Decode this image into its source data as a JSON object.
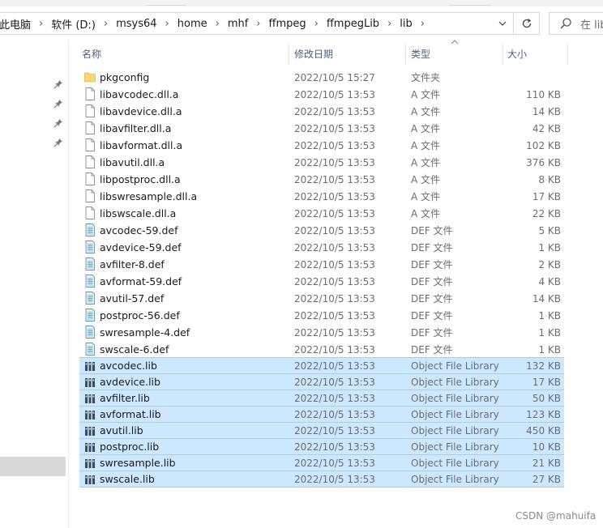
{
  "address_bar": {
    "crumbs": [
      "此电脑",
      "软件 (D:)",
      "msys64",
      "home",
      "mhf",
      "ffmpeg",
      "ffmpegLib",
      "lib"
    ],
    "separator": "›"
  },
  "search": {
    "placeholder": "在 lib"
  },
  "columns": {
    "name": "名称",
    "date": "修改日期",
    "type": "类型",
    "size": "大小"
  },
  "sort": {
    "column": "type",
    "direction": "ascending"
  },
  "colors": {
    "selection_bg": "#cce8ff",
    "selection_border": "#99d1ff",
    "folder": "#f8d775",
    "header_text": "#4d6082"
  },
  "files": [
    {
      "name": "pkgconfig",
      "date": "2022/10/5 15:27",
      "type": "文件夹",
      "size": "",
      "icon": "folder-icon",
      "selected": false
    },
    {
      "name": "libavcodec.dll.a",
      "date": "2022/10/5 13:53",
      "type": "A 文件",
      "size": "110 KB",
      "icon": "file-icon",
      "selected": false
    },
    {
      "name": "libavdevice.dll.a",
      "date": "2022/10/5 13:53",
      "type": "A 文件",
      "size": "14 KB",
      "icon": "file-icon",
      "selected": false
    },
    {
      "name": "libavfilter.dll.a",
      "date": "2022/10/5 13:53",
      "type": "A 文件",
      "size": "42 KB",
      "icon": "file-icon",
      "selected": false
    },
    {
      "name": "libavformat.dll.a",
      "date": "2022/10/5 13:53",
      "type": "A 文件",
      "size": "102 KB",
      "icon": "file-icon",
      "selected": false
    },
    {
      "name": "libavutil.dll.a",
      "date": "2022/10/5 13:53",
      "type": "A 文件",
      "size": "376 KB",
      "icon": "file-icon",
      "selected": false
    },
    {
      "name": "libpostproc.dll.a",
      "date": "2022/10/5 13:53",
      "type": "A 文件",
      "size": "8 KB",
      "icon": "file-icon",
      "selected": false
    },
    {
      "name": "libswresample.dll.a",
      "date": "2022/10/5 13:53",
      "type": "A 文件",
      "size": "17 KB",
      "icon": "file-icon",
      "selected": false
    },
    {
      "name": "libswscale.dll.a",
      "date": "2022/10/5 13:53",
      "type": "A 文件",
      "size": "22 KB",
      "icon": "file-icon",
      "selected": false
    },
    {
      "name": "avcodec-59.def",
      "date": "2022/10/5 13:53",
      "type": "DEF 文件",
      "size": "5 KB",
      "icon": "def-file-icon",
      "selected": false
    },
    {
      "name": "avdevice-59.def",
      "date": "2022/10/5 13:53",
      "type": "DEF 文件",
      "size": "1 KB",
      "icon": "def-file-icon",
      "selected": false
    },
    {
      "name": "avfilter-8.def",
      "date": "2022/10/5 13:53",
      "type": "DEF 文件",
      "size": "2 KB",
      "icon": "def-file-icon",
      "selected": false
    },
    {
      "name": "avformat-59.def",
      "date": "2022/10/5 13:53",
      "type": "DEF 文件",
      "size": "4 KB",
      "icon": "def-file-icon",
      "selected": false
    },
    {
      "name": "avutil-57.def",
      "date": "2022/10/5 13:53",
      "type": "DEF 文件",
      "size": "14 KB",
      "icon": "def-file-icon",
      "selected": false
    },
    {
      "name": "postproc-56.def",
      "date": "2022/10/5 13:53",
      "type": "DEF 文件",
      "size": "1 KB",
      "icon": "def-file-icon",
      "selected": false
    },
    {
      "name": "swresample-4.def",
      "date": "2022/10/5 13:53",
      "type": "DEF 文件",
      "size": "1 KB",
      "icon": "def-file-icon",
      "selected": false
    },
    {
      "name": "swscale-6.def",
      "date": "2022/10/5 13:53",
      "type": "DEF 文件",
      "size": "1 KB",
      "icon": "def-file-icon",
      "selected": false
    },
    {
      "name": "avcodec.lib",
      "date": "2022/10/5 13:53",
      "type": "Object File Library",
      "size": "132 KB",
      "icon": "library-icon",
      "selected": true
    },
    {
      "name": "avdevice.lib",
      "date": "2022/10/5 13:53",
      "type": "Object File Library",
      "size": "17 KB",
      "icon": "library-icon",
      "selected": true
    },
    {
      "name": "avfilter.lib",
      "date": "2022/10/5 13:53",
      "type": "Object File Library",
      "size": "50 KB",
      "icon": "library-icon",
      "selected": true
    },
    {
      "name": "avformat.lib",
      "date": "2022/10/5 13:53",
      "type": "Object File Library",
      "size": "123 KB",
      "icon": "library-icon",
      "selected": true
    },
    {
      "name": "avutil.lib",
      "date": "2022/10/5 13:53",
      "type": "Object File Library",
      "size": "450 KB",
      "icon": "library-icon",
      "selected": true
    },
    {
      "name": "postproc.lib",
      "date": "2022/10/5 13:53",
      "type": "Object File Library",
      "size": "10 KB",
      "icon": "library-icon",
      "selected": true
    },
    {
      "name": "swresample.lib",
      "date": "2022/10/5 13:53",
      "type": "Object File Library",
      "size": "21 KB",
      "icon": "library-icon",
      "selected": true
    },
    {
      "name": "swscale.lib",
      "date": "2022/10/5 13:53",
      "type": "Object File Library",
      "size": "27 KB",
      "icon": "library-icon",
      "selected": true
    }
  ],
  "watermark": "CSDN @mahuifa"
}
